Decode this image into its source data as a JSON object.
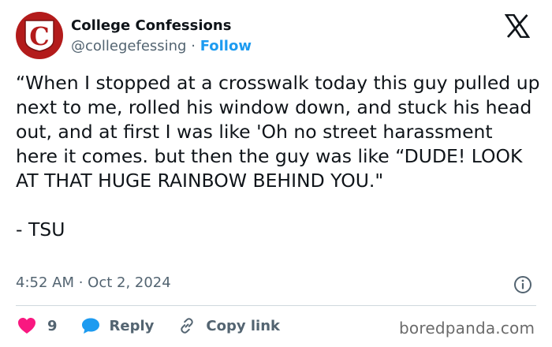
{
  "author": {
    "name": "College Confessions",
    "handle": "@collegefessing",
    "separator": "·",
    "follow_label": "Follow",
    "avatar_letter": "C",
    "avatar_color": "#b31b1b"
  },
  "tweet": {
    "text": "“When I stopped at a crosswalk today this guy pulled up next to me, rolled his window down, and stuck his head out, and at first I was like 'Oh no street harassment here it comes. but then the guy was like “DUDE! LOOK AT THAT HUGE RAINBOW BEHIND YOU.\"\n\n- TSU",
    "timestamp": "4:52 AM · Oct 2, 2024"
  },
  "actions": {
    "like_count": "9",
    "reply_label": "Reply",
    "copy_label": "Copy link"
  },
  "watermark": "boredpanda.com",
  "icons": {
    "platform": "x-logo-icon",
    "info": "info-icon",
    "like": "heart-icon",
    "reply": "speech-bubble-icon",
    "copy": "link-icon"
  },
  "colors": {
    "accent": "#1d9bf0",
    "like": "#f91880",
    "text": "#0f1419",
    "secondary_text": "#536471"
  }
}
